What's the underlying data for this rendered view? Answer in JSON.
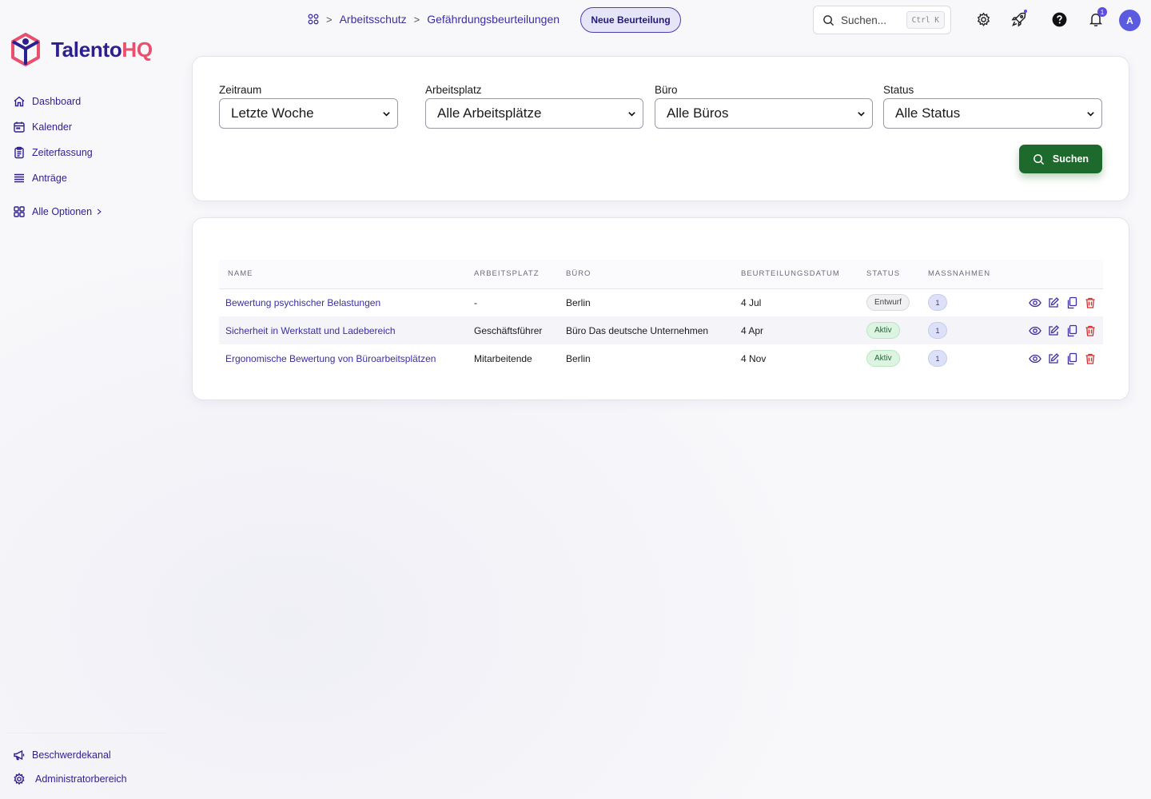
{
  "brand": {
    "name_main": "Talento",
    "name_accent": "HQ"
  },
  "colors": {
    "primary": "#3b2fa0",
    "accent": "#e8506e",
    "success": "#1e6a2c",
    "danger": "#d62b2b"
  },
  "sidebar": {
    "items": [
      {
        "label": "Dashboard",
        "icon": "home-icon"
      },
      {
        "label": "Kalender",
        "icon": "calendar-icon"
      },
      {
        "label": "Zeiterfassung",
        "icon": "clipboard-icon"
      },
      {
        "label": "Anträge",
        "icon": "list-icon"
      }
    ],
    "all_options": "Alle Optionen",
    "bottom": [
      {
        "label": "Beschwerdekanal",
        "icon": "megaphone-icon"
      },
      {
        "label": "Administratorbereich",
        "icon": "gear-icon"
      }
    ]
  },
  "header": {
    "breadcrumb": [
      "Arbeitsschutz",
      "Gefährdungsbeurteilungen"
    ],
    "new_button": "Neue Beurteilung",
    "search_placeholder": "Suchen...",
    "search_shortcut": "Ctrl K",
    "notification_count": "1",
    "avatar_initial": "A"
  },
  "filters": {
    "period": {
      "label": "Zeitraum",
      "value": "Letzte Woche"
    },
    "workplace": {
      "label": "Arbeitsplatz",
      "value": "Alle Arbeitsplätze"
    },
    "office": {
      "label": "Büro",
      "value": "Alle Büros"
    },
    "status": {
      "label": "Status",
      "value": "Alle Status"
    },
    "submit": "Suchen"
  },
  "table": {
    "columns": [
      "NAME",
      "ARBEITSPLATZ",
      "BÜRO",
      "BEURTEILUNGSDATUM",
      "STATUS",
      "MASSNAHMEN"
    ],
    "rows": [
      {
        "name": "Bewertung psychischer Belastungen",
        "workplace": "-",
        "office": "Berlin",
        "date": "4 Jul",
        "status": "Entwurf",
        "measures": "1"
      },
      {
        "name": "Sicherheit in Werkstatt und Ladebereich",
        "workplace": "Geschäftsführer",
        "office": "Büro Das deutsche Unternehmen",
        "date": "4 Apr",
        "status": "Aktiv",
        "measures": "1"
      },
      {
        "name": "Ergonomische Bewertung von Büroarbeitsplätzen",
        "workplace": "Mitarbeitende",
        "office": "Berlin",
        "date": "4 Nov",
        "status": "Aktiv",
        "measures": "1"
      }
    ]
  }
}
